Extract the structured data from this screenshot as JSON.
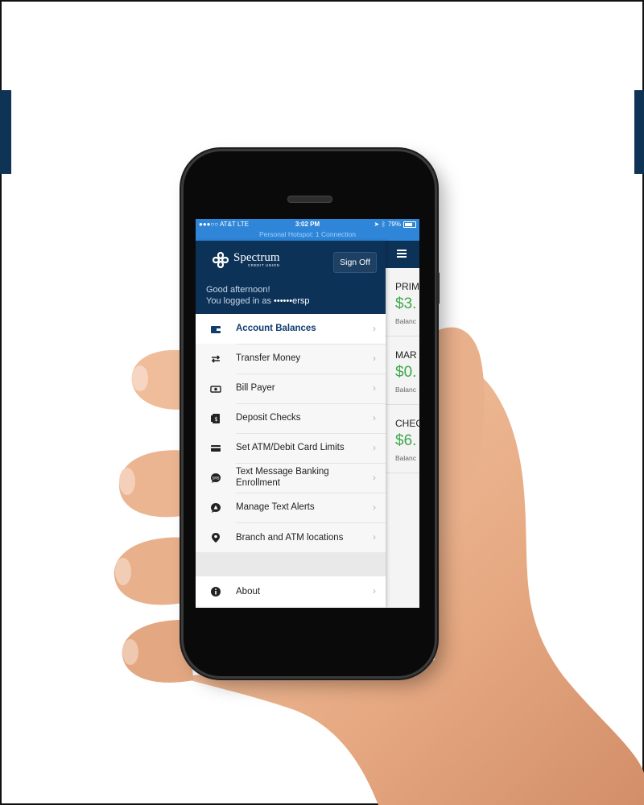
{
  "status_bar": {
    "carrier": "●●●○○ AT&T  LTE",
    "time": "3:02 PM",
    "battery": "79%",
    "battery_level": 0.79,
    "hotspot": "Personal Hotspot: 1 Connection"
  },
  "drawer": {
    "logo_name": "Spectrum",
    "logo_sub": "CREDIT UNION",
    "sign_off_label": "Sign Off",
    "greeting": "Good afternoon!",
    "logged_in_prefix": "You logged in as ",
    "username": "••••••ersp",
    "items": [
      {
        "label": "Account Balances",
        "icon": "wallet-icon",
        "active": true
      },
      {
        "label": "Transfer Money",
        "icon": "transfer-arrows-icon"
      },
      {
        "label": "Bill Payer",
        "icon": "cash-icon"
      },
      {
        "label": "Deposit Checks",
        "icon": "check-deposit-icon"
      },
      {
        "label": "Set ATM/Debit Card Limits",
        "icon": "credit-card-icon"
      },
      {
        "label": "Text Message Banking Enrollment",
        "icon": "sms-bubble-icon"
      },
      {
        "label": "Manage Text Alerts",
        "icon": "alert-bubble-icon"
      },
      {
        "label": "Branch and ATM locations",
        "icon": "map-pin-icon"
      }
    ],
    "about": {
      "label": "About",
      "icon": "info-icon"
    },
    "chevron": "›"
  },
  "main": {
    "menu_icon": "hamburger-icon",
    "accounts": [
      {
        "name": "PRIM",
        "balance": "$3.",
        "caption": "Balanc"
      },
      {
        "name": "MAR",
        "balance": "$0.",
        "caption": "Balanc"
      },
      {
        "name": "CHEC",
        "balance": "$6.",
        "caption": "Balanc"
      }
    ]
  },
  "colors": {
    "navy": "#0d3258",
    "status_blue": "#2f86d9",
    "balance_green": "#3fa84a"
  }
}
